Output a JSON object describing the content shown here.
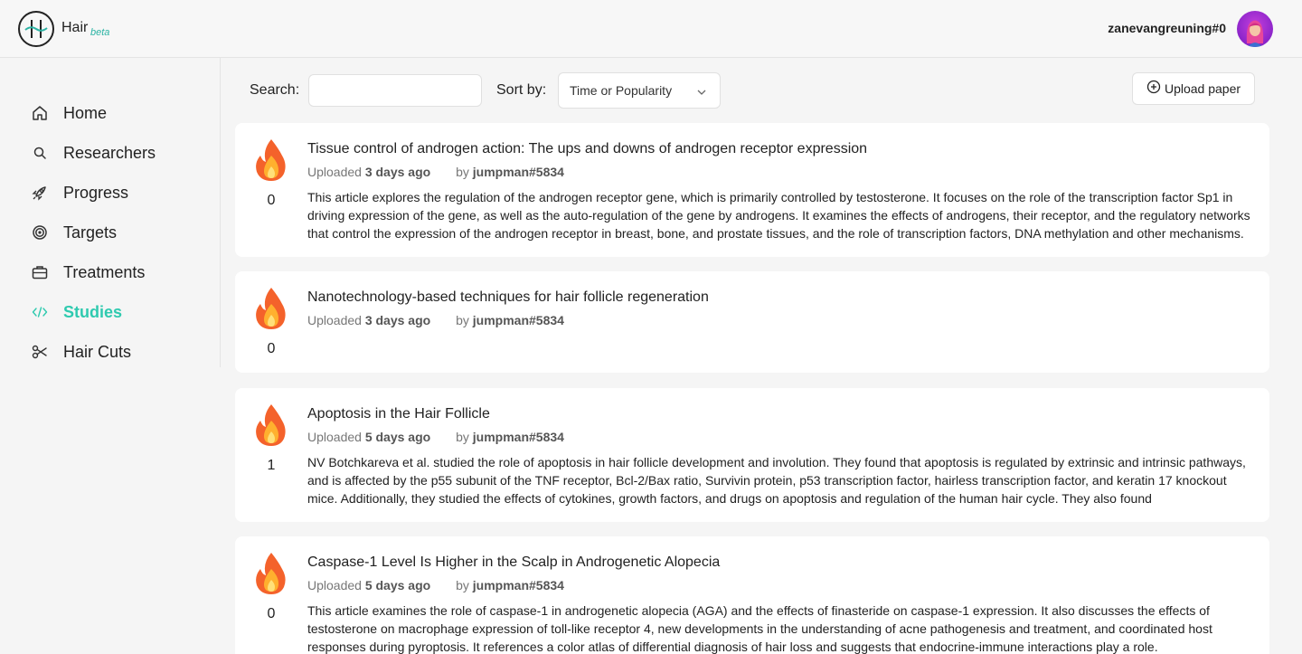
{
  "header": {
    "brand": "Hair",
    "brand_beta": "beta",
    "username": "zanevangreuning#0"
  },
  "sidebar": {
    "items": [
      {
        "label": "Home",
        "icon": "home-icon"
      },
      {
        "label": "Researchers",
        "icon": "search-icon"
      },
      {
        "label": "Progress",
        "icon": "rocket-icon"
      },
      {
        "label": "Targets",
        "icon": "target-icon"
      },
      {
        "label": "Treatments",
        "icon": "briefcase-icon"
      },
      {
        "label": "Studies",
        "icon": "code-icon",
        "active": true
      },
      {
        "label": "Hair Cuts",
        "icon": "scissors-icon"
      }
    ]
  },
  "controls": {
    "search_label": "Search:",
    "search_value": "",
    "sort_label": "Sort by:",
    "sort_value": "Time or Popularity",
    "upload_label": "Upload paper"
  },
  "papers": [
    {
      "votes": "0",
      "title": "Tissue control of androgen action: The ups and downs of androgen receptor expression",
      "uploaded_prefix": "Uploaded",
      "uploaded_time": "3 days ago",
      "by_prefix": "by",
      "author": "jumpman#5834",
      "summary": "This article explores the regulation of the androgen receptor gene, which is primarily controlled by testosterone. It focuses on the role of the transcription factor Sp1 in driving expression of the gene, as well as the auto-regulation of the gene by androgens. It examines the effects of androgens, their receptor, and the regulatory networks that control the expression of the androgen receptor in breast, bone, and prostate tissues, and the role of transcription factors, DNA methylation and other mechanisms."
    },
    {
      "votes": "0",
      "title": "Nanotechnology-based techniques for hair follicle regeneration",
      "uploaded_prefix": "Uploaded",
      "uploaded_time": "3 days ago",
      "by_prefix": "by",
      "author": "jumpman#5834",
      "summary": ""
    },
    {
      "votes": "1",
      "title": "Apoptosis in the Hair Follicle",
      "uploaded_prefix": "Uploaded",
      "uploaded_time": "5 days ago",
      "by_prefix": "by",
      "author": "jumpman#5834",
      "summary": "NV Botchkareva et al. studied the role of apoptosis in hair follicle development and involution. They found that apoptosis is regulated by extrinsic and intrinsic pathways, and is affected by the p55 subunit of the TNF receptor, Bcl-2/Bax ratio, Survivin protein, p53 transcription factor, hairless transcription factor, and keratin 17 knockout mice. Additionally, they studied the effects of cytokines, growth factors, and drugs on apoptosis and regulation of the human hair cycle. They also found"
    },
    {
      "votes": "0",
      "title": "Caspase-1 Level Is Higher in the Scalp in Androgenetic Alopecia",
      "uploaded_prefix": "Uploaded",
      "uploaded_time": "5 days ago",
      "by_prefix": "by",
      "author": "jumpman#5834",
      "summary": "This article examines the role of caspase-1 in androgenetic alopecia (AGA) and the effects of finasteride on caspase-1 expression. It also discusses the effects of testosterone on macrophage expression of toll-like receptor 4, new developments in the understanding of acne pathogenesis and treatment, and coordinated host responses during pyroptosis. It references a color atlas of differential diagnosis of hair loss and suggests that endocrine-immune interactions play a role."
    }
  ]
}
